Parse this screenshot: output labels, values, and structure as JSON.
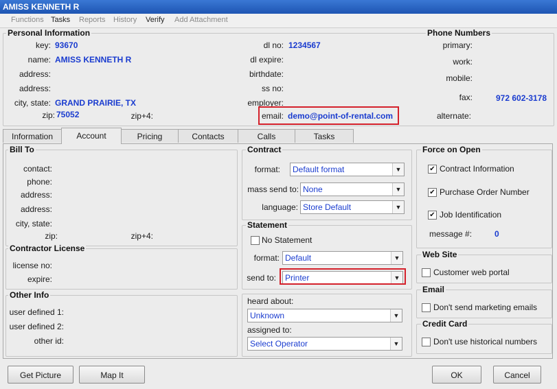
{
  "window": {
    "title": "AMISS KENNETH R"
  },
  "menu": [
    "Functions",
    "Tasks",
    "Reports",
    "History",
    "Verify",
    "Add Attachment"
  ],
  "personal": {
    "heading": "Personal Information",
    "key_label": "key:",
    "key": "93670",
    "name_label": "name:",
    "name": "AMISS KENNETH R",
    "address_label": "address:",
    "city_label": "city, state:",
    "city": "GRAND PRAIRIE, TX",
    "zip_label": "zip:",
    "zip": "75052",
    "zip4_label": "zip+4:",
    "dl_label": "dl no:",
    "dl": "1234567",
    "dl_expire_label": "dl expire:",
    "birthdate_label": "birthdate:",
    "ss_label": "ss no:",
    "employer_label": "employer:",
    "email_label": "email:",
    "email": "demo@point-of-rental.com"
  },
  "phone": {
    "heading": "Phone Numbers",
    "primary_label": "primary:",
    "work_label": "work:",
    "mobile_label": "mobile:",
    "fax_label": "fax:",
    "fax": "972 602-3178",
    "alternate_label": "alternate:"
  },
  "tabs": [
    "Information",
    "Account",
    "Pricing",
    "Contacts",
    "Calls",
    "Tasks"
  ],
  "bill_to": {
    "heading": "Bill To",
    "contact_label": "contact:",
    "phone_label": "phone:",
    "address_label": "address:",
    "city_label": "city, state:",
    "zip_label": "zip:",
    "zip4_label": "zip+4:"
  },
  "contractor": {
    "heading": "Contractor License",
    "license_label": "license no:",
    "expire_label": "expire:"
  },
  "other": {
    "heading": "Other Info",
    "ud1_label": "user defined 1:",
    "ud2_label": "user defined 2:",
    "other_label": "other id:"
  },
  "contract": {
    "heading": "Contract",
    "format_label": "format:",
    "format": "Default format",
    "mass_label": "mass send to:",
    "mass": "None",
    "language_label": "language:",
    "language": "Store Default"
  },
  "statement": {
    "heading": "Statement",
    "no_statement": "No Statement",
    "format_label": "format:",
    "format": "Default",
    "send_label": "send to:",
    "send": "Printer"
  },
  "heard": {
    "heard_label": "heard about:",
    "heard": "Unknown",
    "assigned_label": "assigned to:",
    "assigned": "Select Operator"
  },
  "force": {
    "heading": "Force on Open",
    "contract_info": "Contract Information",
    "po_number": "Purchase Order Number",
    "job_id": "Job Identification",
    "message_label": "message #:",
    "message": "0"
  },
  "website": {
    "heading": "Web Site",
    "portal": "Customer web portal"
  },
  "email_sec": {
    "heading": "Email",
    "no_marketing": "Don't send marketing emails"
  },
  "credit": {
    "heading": "Credit Card",
    "no_historical": "Don't use historical numbers"
  },
  "buttons": {
    "picture": "Get Picture",
    "map": "Map It",
    "ok": "OK",
    "cancel": "Cancel"
  },
  "colors": {
    "value_text": "#1a3ccf",
    "highlight": "#d4202a",
    "title_bar": "#1e55b3"
  },
  "checks": {
    "check_mark": "✔",
    "arrow": "▼"
  }
}
